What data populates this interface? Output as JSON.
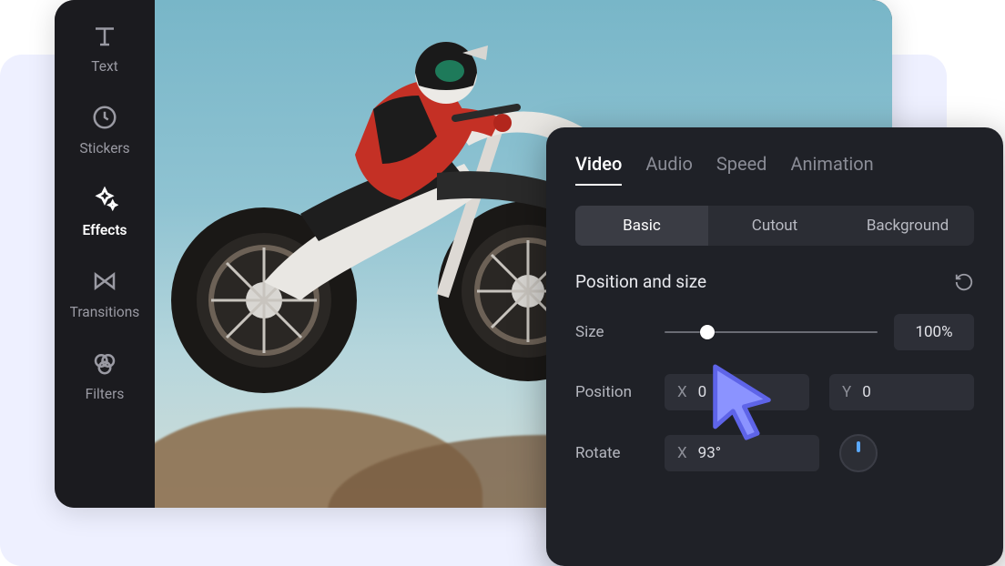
{
  "sidebar": {
    "items": [
      {
        "label": "Text"
      },
      {
        "label": "Stickers"
      },
      {
        "label": "Effects"
      },
      {
        "label": "Transitions"
      },
      {
        "label": "Filters"
      }
    ]
  },
  "panel": {
    "tabs": [
      "Video",
      "Audio",
      "Speed",
      "Animation"
    ],
    "subtabs": [
      "Basic",
      "Cutout",
      "Background"
    ],
    "section_title": "Position and size",
    "size": {
      "label": "Size",
      "value": "100%"
    },
    "position": {
      "label": "Position",
      "x_axis": "X",
      "x": "0",
      "y_axis": "Y",
      "y": "0"
    },
    "rotate": {
      "label": "Rotate",
      "x_axis": "X",
      "value": "93°"
    }
  }
}
